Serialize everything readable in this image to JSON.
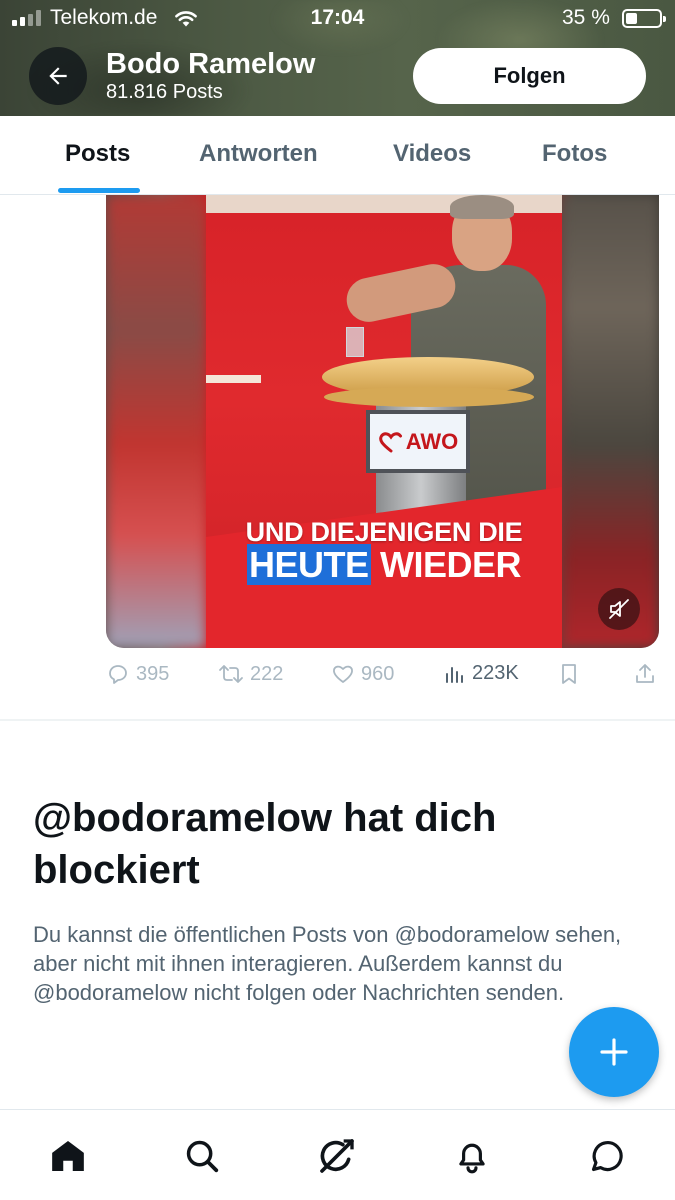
{
  "status_bar": {
    "carrier": "Telekom.de",
    "time": "17:04",
    "battery_percent": "35 %",
    "battery_level": 0.35,
    "signal_bars": 2
  },
  "header": {
    "back_icon": "arrow-left-icon",
    "name": "Bodo Ramelow",
    "post_count": "81.816 Posts",
    "follow_label": "Folgen"
  },
  "tabs": [
    {
      "label": "Posts",
      "active": true
    },
    {
      "label": "Antworten",
      "active": false
    },
    {
      "label": "Videos",
      "active": false
    },
    {
      "label": "Fotos",
      "active": false
    }
  ],
  "media": {
    "sign_text": "AWO",
    "caption_line_1": "UND DIEJENIGEN DIE",
    "caption_line_2_highlight": "HEUTE",
    "caption_line_2_rest": " WIEDER",
    "mute_icon": "muted-speaker-icon"
  },
  "actions": {
    "replies": "395",
    "reposts": "222",
    "likes": "960",
    "views": "223K"
  },
  "blocked": {
    "title": "@bodoramelow hat dich blockiert",
    "text": "Du kannst die öffentlichen Posts von @bodoramelow sehen, aber nicht mit ihnen interagieren. Außerdem kannst du @bodoramelow nicht folgen oder Nachrichten senden."
  },
  "fab_icon": "plus-icon",
  "bottom_nav": [
    "home-icon",
    "search-icon",
    "grok-icon",
    "bell-icon",
    "message-icon"
  ],
  "colors": {
    "accent": "#1d9bf0",
    "text_primary": "#0f1419",
    "text_secondary": "#536471"
  }
}
